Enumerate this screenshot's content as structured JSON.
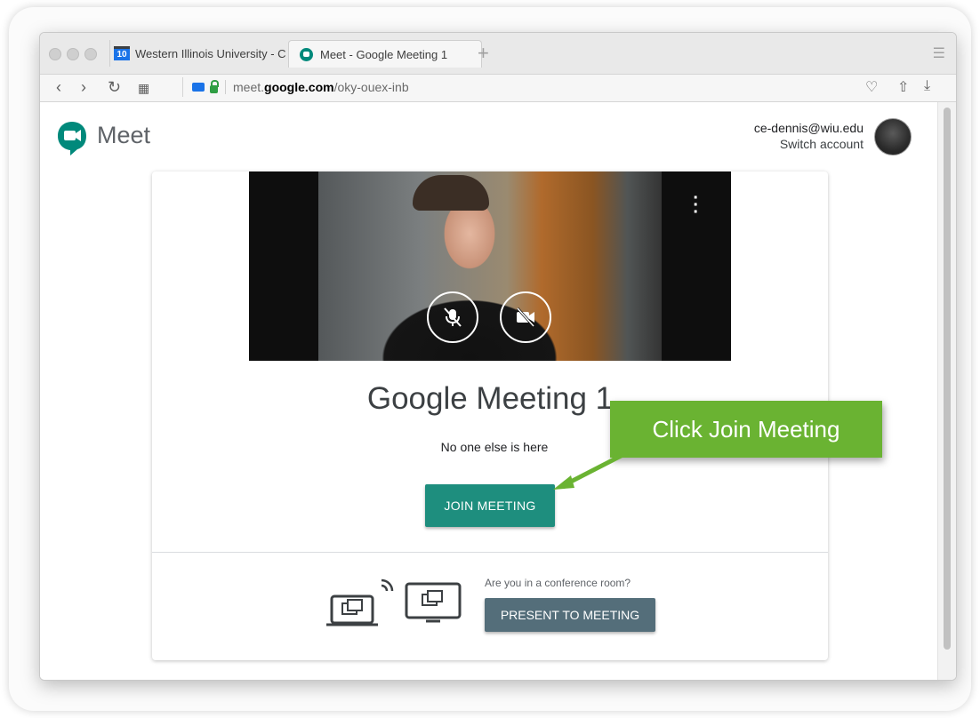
{
  "browser": {
    "tabs": [
      {
        "label": "Western Illinois University - C",
        "icon": "calendar-icon",
        "icon_text": "10"
      },
      {
        "label": "Meet - Google Meeting 1",
        "icon": "meet-icon"
      }
    ],
    "new_tab_label": "+",
    "address": {
      "prefix": "meet.",
      "host": "google.com",
      "path": "/oky-ouex-inb"
    }
  },
  "header": {
    "app_name": "Meet",
    "account_email": "ce-dennis@wiu.edu",
    "switch_account": "Switch account"
  },
  "main": {
    "meeting_name": "Google Meeting 1",
    "status_text": "No one else is here",
    "join_button": "JOIN MEETING",
    "conference_question": "Are you in a conference room?",
    "present_button": "PRESENT TO MEETING"
  },
  "annotation": {
    "callout_text": "Click Join Meeting",
    "callout_color": "#6ab332"
  },
  "colors": {
    "join_button": "#1e8e7e",
    "present_button": "#546e7a",
    "meet_brand": "#00897b"
  }
}
